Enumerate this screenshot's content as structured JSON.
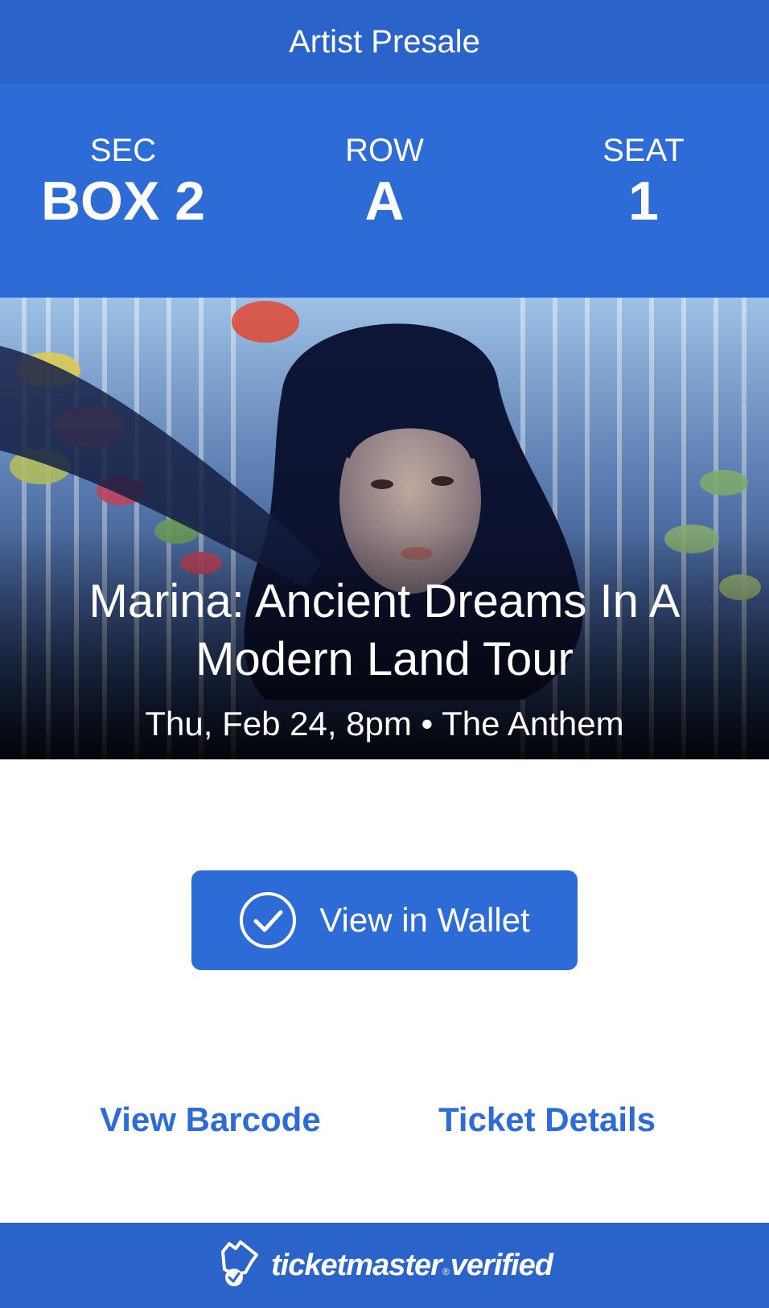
{
  "header": {
    "title": "Artist Presale"
  },
  "seat_info": {
    "sec_label": "SEC",
    "sec_value": "BOX 2",
    "row_label": "ROW",
    "row_value": "A",
    "seat_label": "SEAT",
    "seat_value": "1"
  },
  "event": {
    "title": "Marina: Ancient Dreams In A Modern Land Tour",
    "date_venue": "Thu, Feb 24, 8pm • The Anthem",
    "image_icon": "artist-photo"
  },
  "actions": {
    "wallet_label": "View in Wallet",
    "wallet_icon": "check-circle-icon",
    "barcode_label": "View Barcode",
    "details_label": "Ticket Details"
  },
  "footer": {
    "brand": "ticketmaster",
    "reg_mark": "®",
    "verified": "verified",
    "logo_icon": "verified-ticket-icon"
  },
  "colors": {
    "header_blue": "#2a63c9",
    "band_blue": "#2d6bd6",
    "link_blue": "#2d6bd6",
    "text_white": "#ffffff"
  }
}
